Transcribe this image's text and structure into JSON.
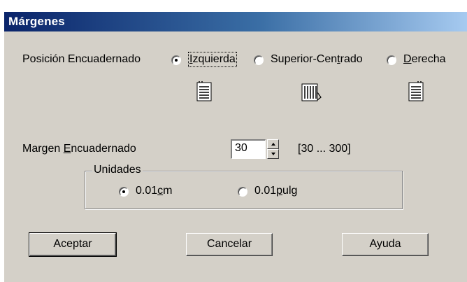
{
  "window": {
    "title": "Márgenes"
  },
  "binding_position": {
    "label": "Posición Encuadernado",
    "options": [
      {
        "label_prefix": "",
        "label_accel": "I",
        "label_suffix": "zquierda",
        "selected": true
      },
      {
        "label_prefix": "Superior-Cen",
        "label_accel": "t",
        "label_suffix": "rado",
        "selected": false
      },
      {
        "label_prefix": "",
        "label_accel": "D",
        "label_suffix": "erecha",
        "selected": false
      }
    ]
  },
  "binding_margin": {
    "label_prefix": "Margen ",
    "label_accel": "E",
    "label_suffix": "ncuadernado",
    "value": "30",
    "range": "[30 ... 300]"
  },
  "units": {
    "group_label": "Unidades",
    "options": [
      {
        "label_prefix": "0.01",
        "label_accel": "c",
        "label_suffix": "m",
        "selected": true
      },
      {
        "label_prefix": "0.01",
        "label_accel": "p",
        "label_suffix": "ulg",
        "selected": false
      }
    ]
  },
  "buttons": {
    "ok": "Aceptar",
    "cancel": "Cancelar",
    "help": "Ayuda"
  },
  "icons": {
    "doc_left": "document-left-binding-icon",
    "doc_top": "document-top-binding-icon",
    "doc_right": "document-right-binding-icon"
  },
  "colors": {
    "title_bar_start": "#0a246a",
    "title_bar_end": "#a6caf0",
    "dialog_face": "#d4d0c8"
  }
}
